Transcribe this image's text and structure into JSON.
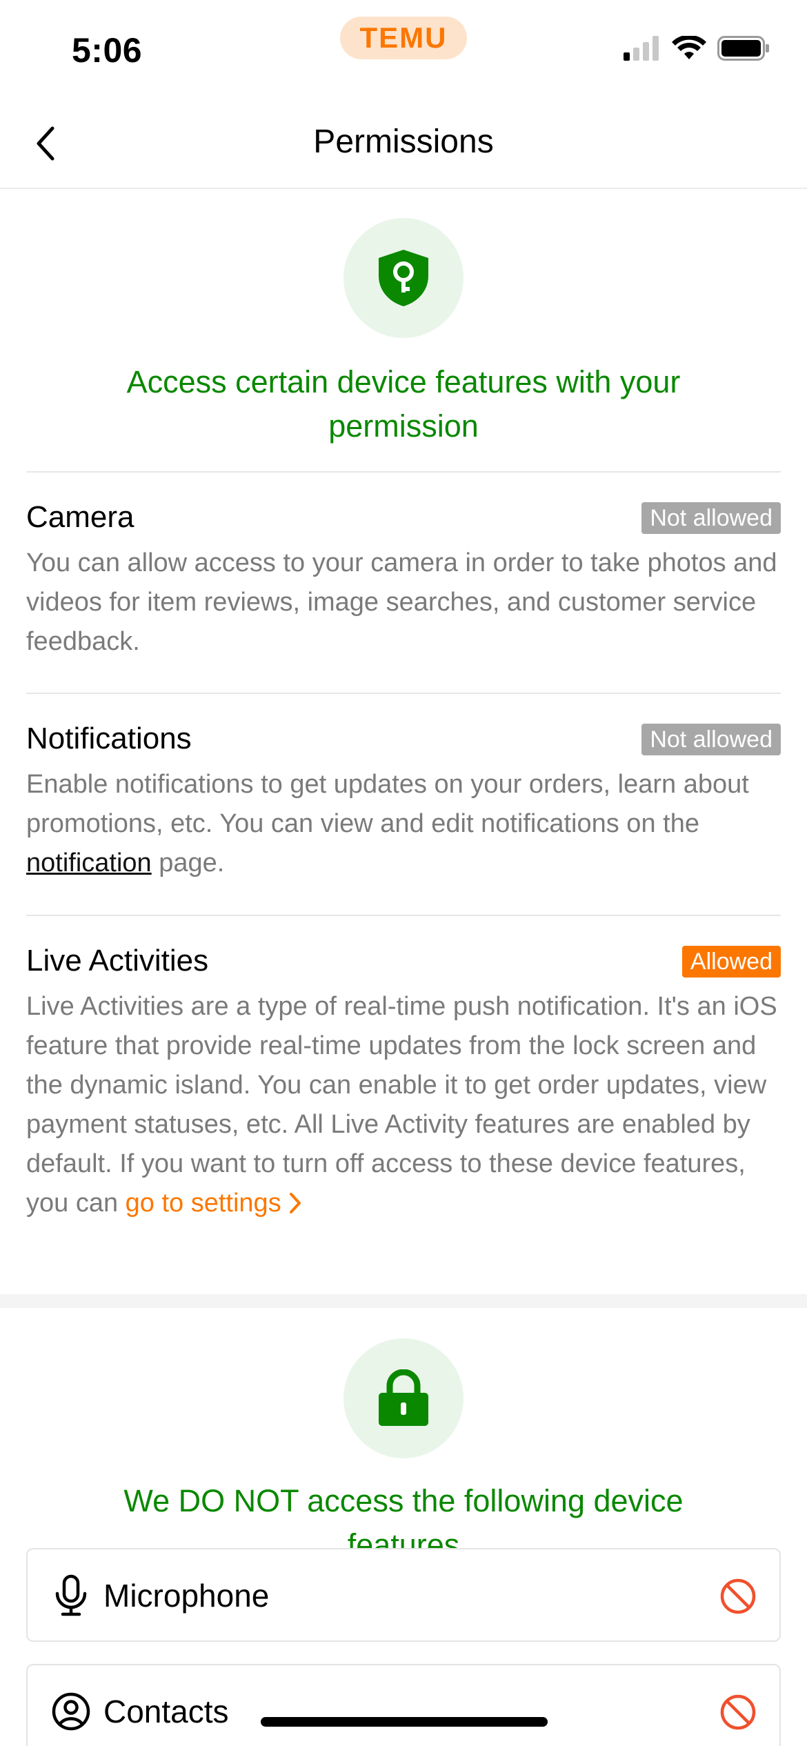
{
  "status_bar": {
    "time": "5:06",
    "app_badge": "TEMU",
    "icons": [
      "cellular-signal-icon",
      "wifi-icon",
      "battery-icon"
    ]
  },
  "nav": {
    "title": "Permissions",
    "back_icon": "chevron-left-icon"
  },
  "access_section": {
    "icon": "shield-key-icon",
    "heading": "Access certain device features with your permission",
    "permissions": [
      {
        "title": "Camera",
        "status": "Not allowed",
        "description": "You can allow access to your camera in order to take photos and videos for item reviews, image searches, and customer service feedback."
      },
      {
        "title": "Notifications",
        "status": "Not allowed",
        "description_before": "Enable notifications to get updates on your orders, learn about promotions, etc. You can view and edit notifications on the ",
        "link_text": "notification",
        "description_after": " page."
      },
      {
        "title": "Live Activities",
        "status": "Allowed",
        "description": "Live Activities are a type of real-time push notification. It's an iOS feature that provide real-time updates from the lock screen and the dynamic island. You can enable it to get order updates, view payment statuses, etc. All Live Activity features are enabled by default. If you want to turn off access to these device features, you can ",
        "link_text": "go to settings"
      }
    ]
  },
  "no_access_section": {
    "icon": "lock-icon",
    "heading": "We DO NOT access the following device features",
    "features": [
      {
        "label": "Microphone",
        "icon": "microphone-icon",
        "status_icon": "prohibited-icon"
      },
      {
        "label": "Contacts",
        "icon": "contact-person-icon",
        "status_icon": "prohibited-icon"
      }
    ]
  },
  "colors": {
    "green": "#0a8800",
    "orange": "#fb7701",
    "grey_badge": "#a7a7a7",
    "prohibited": "#f0502d"
  }
}
